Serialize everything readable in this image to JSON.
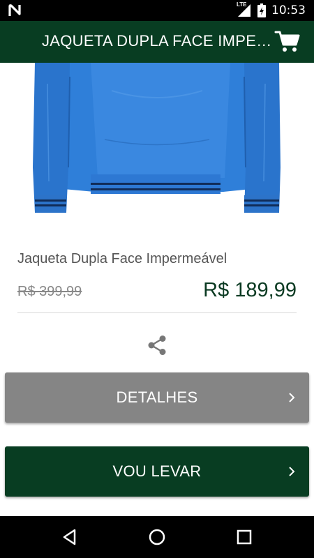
{
  "status_bar": {
    "time": "10:53",
    "network": "LTE",
    "icons": [
      "notification-n-icon",
      "signal-icon",
      "battery-charging-icon"
    ]
  },
  "toolbar": {
    "title": "JAQUETA DUPLA FACE IMPERMEÁVEL",
    "cart_icon": "shopping-cart-icon"
  },
  "product": {
    "image": "blue-jacket-photo",
    "name": "Jaqueta Dupla Face Impermeável",
    "old_price": "R$ 399,99",
    "price": "R$ 189,99",
    "share_icon": "share-icon"
  },
  "buttons": {
    "details_label": "DETALHES",
    "buy_label": "VOU LEVAR",
    "chevron_icon": "chevron-right-icon"
  },
  "nav_bar": {
    "icons": [
      "back-icon",
      "home-icon",
      "recents-icon"
    ]
  },
  "colors": {
    "primary": "#083d22",
    "details_button": "#858585",
    "price": "#0b3a22",
    "jacket": "#2f7fd9"
  }
}
